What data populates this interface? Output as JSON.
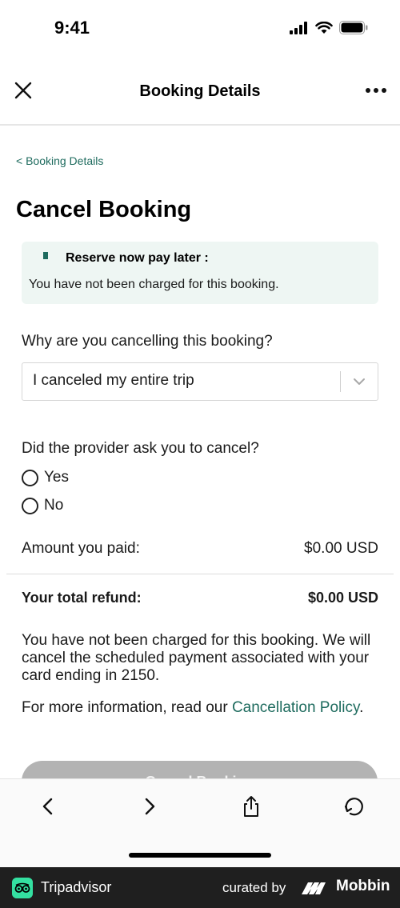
{
  "status_bar": {
    "time": "9:41"
  },
  "nav": {
    "title": "Booking Details"
  },
  "breadcrumb": "< Booking Details",
  "page_title": "Cancel Booking",
  "notice": {
    "title": "Reserve now pay later :",
    "text": "You have not been charged for this booking."
  },
  "reason": {
    "question": "Why are you cancelling this booking?",
    "selected": "I canceled my entire trip"
  },
  "provider": {
    "question": "Did the provider ask you to cancel?",
    "options": [
      "Yes",
      "No"
    ]
  },
  "amount": {
    "label": "Amount you paid:",
    "value": "$0.00 USD"
  },
  "refund": {
    "label": "Your total refund:",
    "value": "$0.00 USD"
  },
  "info_text": "You have not been charged for this booking. We will cancel the scheduled payment associated with your card ending in 2150.",
  "policy": {
    "prefix": "For more information, read our ",
    "link": "Cancellation Policy",
    "suffix": "."
  },
  "cancel_button": "Cancel Booking",
  "footer": {
    "brand": "Tripadvisor",
    "curated": "curated by",
    "mobbin": "Mobbin"
  },
  "colors": {
    "accent": "#1e6b5e",
    "notice_bg": "#eef6f3",
    "button_disabled": "#b3b3b3",
    "footer_bg": "#1f1f1f",
    "tripadvisor_green": "#34e0a1"
  },
  "icons": [
    "signal-icon",
    "wifi-icon",
    "battery-icon",
    "close-icon",
    "more-icon",
    "chevron-down-icon",
    "back-icon",
    "forward-icon",
    "share-icon",
    "refresh-icon",
    "tripadvisor-logo-icon",
    "mobbin-logo-icon"
  ]
}
